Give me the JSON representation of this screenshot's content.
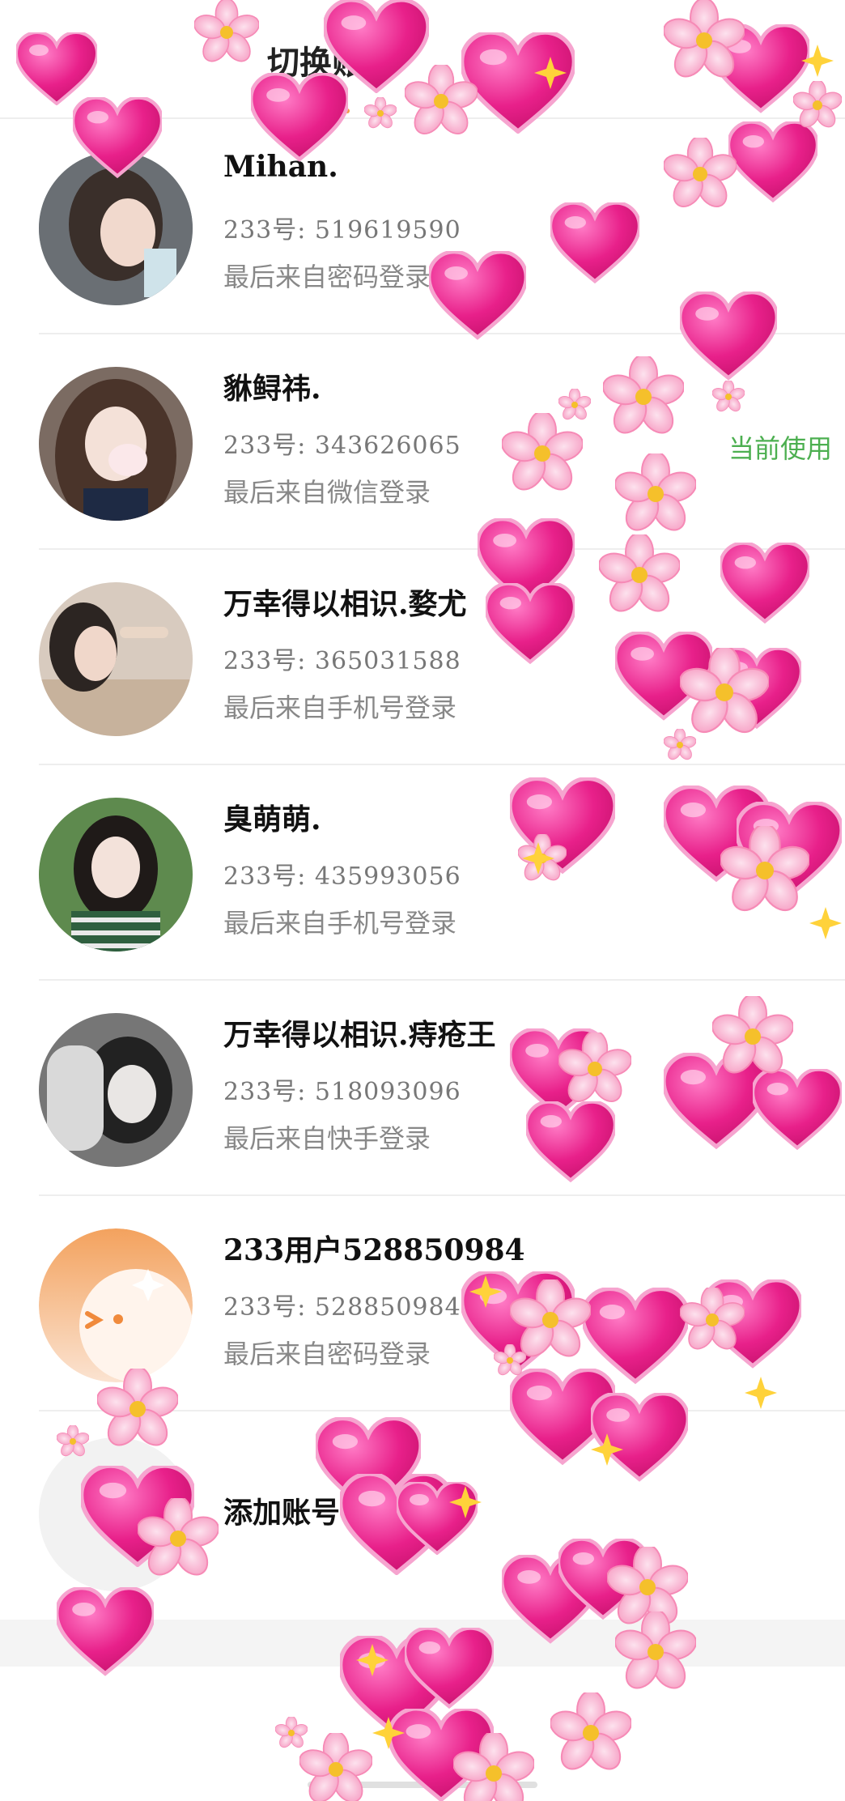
{
  "tabs": {
    "switch_label": "切换账号",
    "second_label": "账号"
  },
  "accounts": [
    {
      "name": "Mihan.",
      "uid": "233号: 519619590",
      "login": "最后来自密码登录",
      "badge": ""
    },
    {
      "name": "貅鲟祎.",
      "uid": "233号: 343626065",
      "login": "最后来自微信登录",
      "badge": "当前使用"
    },
    {
      "name": "万幸得以相识.婺尤",
      "uid": "233号: 365031588",
      "login": "最后来自手机号登录",
      "badge": ""
    },
    {
      "name": "臭萌萌.",
      "uid": "233号: 435993056",
      "login": "最后来自手机号登录",
      "badge": ""
    },
    {
      "name": "万幸得以相识.痔疮王",
      "uid": "233号: 518093096",
      "login": "最后来自快手登录",
      "badge": ""
    },
    {
      "name": "233用户528850984",
      "uid": "233号: 528850984",
      "login": "最后来自密码登录",
      "badge": ""
    }
  ],
  "add_account": {
    "label": "添加账号"
  },
  "colors": {
    "accent": "#f39a43",
    "current_badge": "#4caf50",
    "heart_pink": "#e8208a",
    "flower_pink": "#f7a3c7"
  },
  "icons": {
    "add": "plus-icon",
    "decoration_hearts": "heart-icon",
    "decoration_flowers": "sakura-icon"
  }
}
